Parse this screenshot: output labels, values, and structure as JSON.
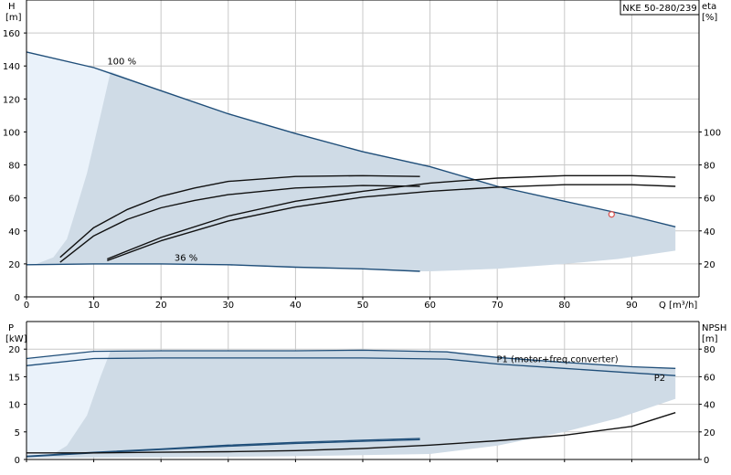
{
  "chart_data": [
    {
      "panel": "head-efficiency",
      "type": "line",
      "title": "NKE 50-280/239",
      "xlabel": "Q [m³/h]",
      "ylabel_left": [
        "H",
        "[m]"
      ],
      "ylabel_right": [
        "eta",
        "[%]"
      ],
      "xlim": [
        0,
        100
      ],
      "ylim": [
        0,
        180
      ],
      "y2lim": [
        0,
        180
      ],
      "x_ticks": [
        0,
        10,
        20,
        30,
        40,
        50,
        60,
        70,
        80,
        90
      ],
      "y_ticks": [
        0,
        20,
        40,
        60,
        80,
        100,
        120,
        140,
        160
      ],
      "y2_ticks": [
        20,
        40,
        60,
        80,
        100
      ],
      "grid": true,
      "labels": [
        {
          "text": "100 %",
          "x": 12,
          "y": 141
        },
        {
          "text": "36 %",
          "x": 22,
          "y": 22
        }
      ],
      "operating_point": {
        "x": 87,
        "y": 50
      },
      "range_area": {
        "upper": [
          [
            0,
            148.5
          ],
          [
            12.5,
            136.5
          ],
          [
            20,
            125
          ],
          [
            30,
            111
          ],
          [
            40,
            99
          ],
          [
            50,
            88
          ],
          [
            60,
            79
          ],
          [
            70,
            67
          ],
          [
            80,
            58
          ],
          [
            90,
            49
          ],
          [
            96.5,
            42.5
          ]
        ],
        "lower": [
          [
            0,
            19.5
          ],
          [
            10,
            20
          ],
          [
            20,
            20
          ],
          [
            30,
            19.5
          ],
          [
            40,
            18
          ],
          [
            50,
            17
          ],
          [
            58.5,
            15.5
          ],
          [
            60,
            15.5
          ],
          [
            70,
            17
          ],
          [
            80,
            20
          ],
          [
            88,
            23
          ],
          [
            96.5,
            28
          ]
        ],
        "light_upper": [
          [
            0,
            148.5
          ],
          [
            12.5,
            136.5
          ]
        ],
        "light_boundary": [
          [
            12.5,
            136.5
          ],
          [
            11,
            110
          ],
          [
            9,
            75
          ],
          [
            7,
            48
          ],
          [
            6,
            35
          ],
          [
            4,
            24
          ],
          [
            1.5,
            20
          ],
          [
            0,
            19.5
          ]
        ]
      },
      "series": [
        {
          "name": "100 %",
          "style": "head",
          "points": [
            [
              0,
              148.5
            ],
            [
              10,
              139
            ],
            [
              20,
              125
            ],
            [
              30,
              111
            ],
            [
              40,
              99
            ],
            [
              50,
              88
            ],
            [
              60,
              79
            ],
            [
              70,
              67
            ],
            [
              80,
              58
            ],
            [
              90,
              49
            ],
            [
              96.5,
              42.5
            ]
          ]
        },
        {
          "name": "36 %",
          "style": "head",
          "points": [
            [
              0,
              19.5
            ],
            [
              10,
              20
            ],
            [
              20,
              20
            ],
            [
              30,
              19.5
            ],
            [
              40,
              18
            ],
            [
              50,
              17
            ],
            [
              58.5,
              15.5
            ]
          ]
        },
        {
          "style": "eta",
          "points": [
            [
              5,
              24
            ],
            [
              10,
              42
            ],
            [
              15,
              53
            ],
            [
              20,
              61
            ],
            [
              25,
              66
            ],
            [
              30,
              70
            ],
            [
              40,
              73
            ],
            [
              50,
              73.5
            ],
            [
              58.5,
              73
            ]
          ]
        },
        {
          "style": "eta",
          "points": [
            [
              5,
              21
            ],
            [
              10,
              37
            ],
            [
              15,
              47
            ],
            [
              20,
              54
            ],
            [
              25,
              58.5
            ],
            [
              30,
              62
            ],
            [
              40,
              66
            ],
            [
              50,
              67.5
            ],
            [
              58.5,
              67
            ]
          ]
        },
        {
          "style": "eta",
          "points": [
            [
              12,
              23
            ],
            [
              20,
              36
            ],
            [
              30,
              49
            ],
            [
              40,
              58
            ],
            [
              50,
              64
            ],
            [
              60,
              69
            ],
            [
              70,
              72
            ],
            [
              80,
              73.5
            ],
            [
              90,
              73.5
            ],
            [
              96.5,
              72.5
            ]
          ]
        },
        {
          "style": "eta",
          "points": [
            [
              12,
              22
            ],
            [
              20,
              34
            ],
            [
              30,
              46
            ],
            [
              40,
              54.5
            ],
            [
              50,
              60.5
            ],
            [
              60,
              64
            ],
            [
              70,
              66.5
            ],
            [
              80,
              68
            ],
            [
              90,
              68
            ],
            [
              96.5,
              67
            ]
          ]
        }
      ]
    },
    {
      "panel": "power-npsh",
      "type": "line",
      "xlabel": "",
      "ylabel_left": [
        "P",
        "[kW]"
      ],
      "ylabel_right": [
        "NPSH",
        "[m]"
      ],
      "xlim": [
        0,
        100
      ],
      "ylim": [
        0,
        25
      ],
      "y2lim": [
        0,
        100
      ],
      "x_ticks": [
        0,
        10,
        20,
        30,
        40,
        50,
        60,
        70,
        80,
        90
      ],
      "y_ticks": [
        0,
        5,
        10,
        15,
        20
      ],
      "y2_ticks": [
        0,
        20,
        40,
        60,
        80
      ],
      "grid": true,
      "labels": [
        {
          "text": "P1 (motor+freq.converter)",
          "x": 88,
          "y": 17.6
        },
        {
          "text": "P2",
          "x": 95,
          "y": 14.2
        }
      ],
      "range_area": {
        "upper": [
          [
            0,
            18.3
          ],
          [
            12.5,
            19.7
          ],
          [
            30,
            19.7
          ],
          [
            50,
            19.8
          ],
          [
            62.5,
            19.5
          ],
          [
            70,
            18.5
          ],
          [
            80,
            17.6
          ],
          [
            90,
            16.8
          ],
          [
            96.5,
            16.5
          ]
        ],
        "lower": [
          [
            0,
            0.3
          ],
          [
            20,
            0.4
          ],
          [
            40,
            0.6
          ],
          [
            60,
            1.0
          ],
          [
            70,
            2.5
          ],
          [
            80,
            5
          ],
          [
            88,
            7.5
          ],
          [
            96.5,
            11
          ]
        ],
        "light_upper": [
          [
            0,
            18.3
          ],
          [
            12.5,
            19.7
          ]
        ],
        "light_boundary": [
          [
            12.5,
            19.7
          ],
          [
            11,
            15
          ],
          [
            9,
            8
          ],
          [
            6,
            2.5
          ],
          [
            4,
            1
          ],
          [
            0,
            0.3
          ]
        ]
      },
      "series": [
        {
          "name": "P1 (motor+freq.converter)",
          "style": "power",
          "points": [
            [
              0,
              18.3
            ],
            [
              10,
              19.6
            ],
            [
              20,
              19.7
            ],
            [
              30,
              19.7
            ],
            [
              40,
              19.7
            ],
            [
              50,
              19.8
            ],
            [
              62.5,
              19.5
            ],
            [
              70,
              18.5
            ],
            [
              80,
              17.6
            ],
            [
              90,
              16.8
            ],
            [
              96.5,
              16.5
            ]
          ]
        },
        {
          "name": "P2",
          "style": "power",
          "points": [
            [
              0,
              17
            ],
            [
              10,
              18.3
            ],
            [
              20,
              18.4
            ],
            [
              30,
              18.4
            ],
            [
              40,
              18.4
            ],
            [
              50,
              18.4
            ],
            [
              62.5,
              18.2
            ],
            [
              70,
              17.3
            ],
            [
              80,
              16.5
            ],
            [
              90,
              15.7
            ],
            [
              96.5,
              15.2
            ]
          ]
        },
        {
          "style": "power",
          "points": [
            [
              0,
              0.6
            ],
            [
              10,
              1.3
            ],
            [
              20,
              1.9
            ],
            [
              30,
              2.6
            ],
            [
              40,
              3.1
            ],
            [
              50,
              3.5
            ],
            [
              58.5,
              3.8
            ]
          ]
        },
        {
          "style": "power",
          "points": [
            [
              0,
              0.5
            ],
            [
              10,
              1.2
            ],
            [
              20,
              1.8
            ],
            [
              30,
              2.4
            ],
            [
              40,
              2.9
            ],
            [
              50,
              3.3
            ],
            [
              58.5,
              3.6
            ]
          ]
        },
        {
          "style": "npsh",
          "points": [
            [
              0,
              1.2
            ],
            [
              10,
              1.2
            ],
            [
              20,
              1.3
            ],
            [
              30,
              1.4
            ],
            [
              40,
              1.6
            ],
            [
              50,
              2
            ],
            [
              60,
              2.6
            ],
            [
              70,
              3.4
            ],
            [
              80,
              4.4
            ],
            [
              90,
              6
            ],
            [
              96.5,
              8.5
            ]
          ]
        }
      ]
    }
  ]
}
